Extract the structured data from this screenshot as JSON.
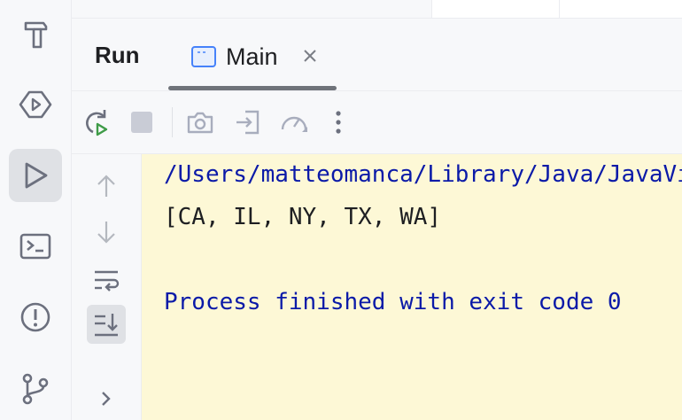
{
  "run_panel": {
    "title": "Run",
    "tab": {
      "label": "Main",
      "icon": "console-window-icon"
    }
  },
  "left_toolbar": [
    {
      "id": "build",
      "icon": "hammer-icon",
      "active": false
    },
    {
      "id": "services",
      "icon": "services-icon",
      "active": false
    },
    {
      "id": "run",
      "icon": "run-icon",
      "active": true
    },
    {
      "id": "terminal",
      "icon": "terminal-icon",
      "active": false
    },
    {
      "id": "problems",
      "icon": "problems-icon",
      "active": false
    },
    {
      "id": "git",
      "icon": "git-branch-icon",
      "active": false
    }
  ],
  "run_toolbar": [
    "rerun-icon",
    "stop-icon",
    "screenshot-icon",
    "attach-debugger-icon",
    "profiler-icon",
    "more-options-icon"
  ],
  "console_side_toolbar": [
    "scroll-up-icon",
    "scroll-down-icon",
    "soft-wrap-icon",
    "scroll-to-end-icon",
    "expand-icon"
  ],
  "console": {
    "lines": [
      {
        "text": "/Users/matteomanca/Library/Java/JavaVirtualMachines",
        "color": "#0b1aa8"
      },
      {
        "text": "[CA, IL, NY, TX, WA]",
        "color": "#1e1f22"
      },
      {
        "text": "",
        "color": "#1e1f22"
      },
      {
        "text": "Process finished with exit code 0",
        "color": "#0b1aa8"
      }
    ]
  },
  "colors": {
    "console_background": "#fdf8d6",
    "active_button": "#dfe1e5",
    "icon_gray": "#6c707e",
    "run_green": "#3e9b47"
  }
}
